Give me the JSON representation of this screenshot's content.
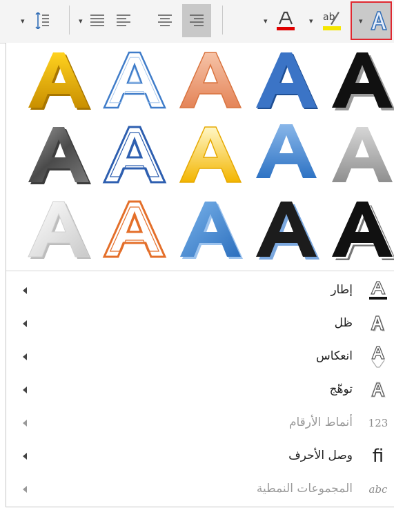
{
  "toolbar": {
    "buttons": [
      {
        "name": "line-spacing-dropdown",
        "icon": "line-spacing-icon"
      },
      {
        "name": "justify",
        "icon": "align-justify-icon"
      },
      {
        "name": "align-left",
        "icon": "align-left-icon"
      },
      {
        "name": "align-center",
        "icon": "align-center-icon"
      },
      {
        "name": "align-right",
        "icon": "align-right-icon",
        "state": "selected"
      },
      {
        "name": "font-color",
        "icon": "font-color-icon",
        "letter": "A",
        "color": "#e00000"
      },
      {
        "name": "highlight",
        "icon": "highlight-icon",
        "letter": "ab",
        "color": "#f5e600"
      },
      {
        "name": "text-effects",
        "icon": "text-effects-icon",
        "letter": "A",
        "state": "open",
        "outline_color": "#e0272f"
      }
    ]
  },
  "gallery": {
    "letter": "A",
    "rows": [
      [
        "gold-gradient",
        "blue-outline",
        "orange-soft",
        "blue-solid",
        "black-shadow"
      ],
      [
        "gray-gradient",
        "blue-outline-thick",
        "gold-light",
        "blue-reflection",
        "gray-light"
      ],
      [
        "white-bevel",
        "orange-outline",
        "blue-bevel",
        "black-bevel",
        "black-white-outline"
      ]
    ]
  },
  "menu": {
    "items": [
      {
        "label": "إطار",
        "icon": "outline-icon",
        "enabled": true
      },
      {
        "label": "ظل",
        "icon": "shadow-icon",
        "enabled": true
      },
      {
        "label": "انعكاس",
        "icon": "reflection-icon",
        "enabled": true
      },
      {
        "label": "توهّج",
        "icon": "glow-icon",
        "enabled": true
      },
      {
        "label": "أنماط الأرقام",
        "icon": "number-styles-icon",
        "icon_text": "123",
        "enabled": false
      },
      {
        "label": "وصل الأحرف",
        "icon": "ligatures-icon",
        "icon_text": "fi",
        "enabled": true
      },
      {
        "label": "المجموعات النمطية",
        "icon": "stylistic-sets-icon",
        "icon_text": "abc",
        "enabled": false
      }
    ]
  },
  "colors": {
    "accent_red": "#e0272f",
    "selected_bg": "#c8c8c8",
    "text": "#222222",
    "disabled_text": "#9a9a9a"
  }
}
